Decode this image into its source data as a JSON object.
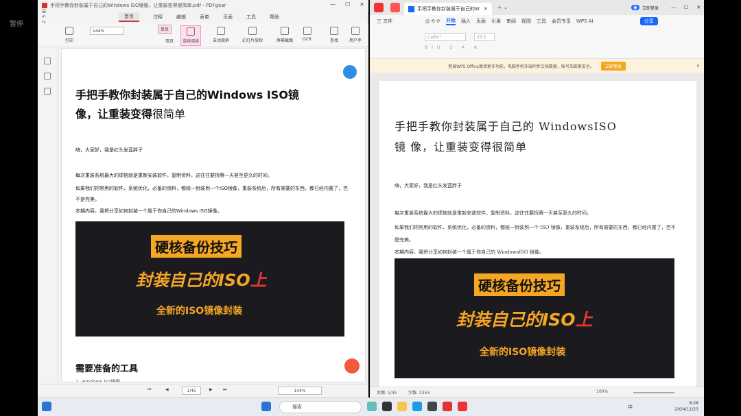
{
  "watermark": "暂停",
  "left_window": {
    "title": "手把手教你封装属于自己的Windows ISO镜像，让重装变得很简单.pdf - PDFgear",
    "menu": [
      "首页",
      "注释",
      "编辑",
      "表单",
      "页面",
      "工具",
      "帮助"
    ],
    "toolbar": {
      "zoom": "144%",
      "labels": [
        "打印",
        "单页",
        "双页",
        "连续阅读",
        "自动滚屏",
        "幻灯片放映",
        "屏幕截图",
        "OCR",
        "查找",
        "用户手"
      ]
    },
    "page": {
      "title_line1": "手把手教你封装属于自己的Windows ISO镜",
      "title_line2a": "像，让重装变得",
      "title_line2b": "很简单",
      "greet": "嗨，大家好，我是红头发蓝胖子",
      "p1": "每次重装系统最大的烦恼就是重新安装软件，复制资料，这往往要折腾一天甚至更久的时间。",
      "p2": "如果我们把常用的软件、系统优化，必备的资料，都统一封装到一个ISO镜像，重装系统后，所有需要的东西，都已经内置了，岂不是完美。",
      "p3": "本期内容，我将分享如何封装一个属于你自己的Windows ISO镜像。",
      "banner1": "硬核备份技巧",
      "banner2": "封装自己的ISO",
      "banner2b": "上",
      "banner3": "全新的ISO镜像封装",
      "h2": "需要准备的工具",
      "li1": "1.  windows iso镜像"
    },
    "bottom": {
      "page": "1/45",
      "zoom": "144%"
    }
  },
  "right_window": {
    "tab_title": "手把手教你封装属于自己的W",
    "login": "立即登录",
    "menu": [
      "三 文件",
      "开始",
      "插入",
      "页面",
      "引用",
      "审阅",
      "视图",
      "工具",
      "会员专享",
      "WPS AI"
    ],
    "share": "分享",
    "ribbon": {
      "font": "Calibri",
      "size": "25.5"
    },
    "notice": "登录WPS Office激活更多功能，电脑手机多端同步文档数据，账号加密更安全。",
    "notice_btn": "立即登录",
    "page": {
      "title_line1": "手把手教你封装属于自己的 WindowsISO",
      "title_line2": "镜 像，让重装变得很简单",
      "greet": "嗨，大家好，我是红头发蓝胖子",
      "p1": "每次重装系统最大的烦恼就是重新安装软件，复制资料，这往往要折腾一天甚至更久的时间。",
      "p2": "如果我们把常用的软件、系统优化，必备的资料，都统一封装到一个 ISO 镜像，重装系统后，所有需要的东西，都已经内置了，岂不是完美。",
      "p3": "本期内容，我将分享如何封装一个属于你自己的 WindowsISO 镜像。",
      "banner1": "硬核备份技巧",
      "banner2": "封装自己的ISO",
      "banner2b": "上",
      "banner3": "全新的ISO镜像封装"
    },
    "status": {
      "page": "页面: 1/45",
      "words": "字数: 2353",
      "zoom": "100%"
    }
  },
  "taskbar": {
    "search": "搜索",
    "time": "8:28",
    "date": "2024/11/23",
    "lang": "中"
  }
}
